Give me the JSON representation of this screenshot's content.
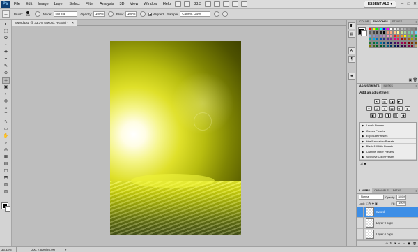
{
  "menubar": {
    "logo": "Ps",
    "items": [
      "File",
      "Edit",
      "Image",
      "Layer",
      "Select",
      "Filter",
      "Analysis",
      "3D",
      "View",
      "Window",
      "Help"
    ],
    "zoom": "33.3",
    "workspace": "ESSENTIALS ▾",
    "win_min": "–",
    "win_max": "□",
    "win_close": "✕"
  },
  "options": {
    "brush_label": "Brush:",
    "brush_size": "336",
    "mode_label": "Mode:",
    "mode_value": "Normal",
    "opacity_label": "Opacity:",
    "opacity_value": "100%",
    "flow_label": "Flow:",
    "flow_value": "100%",
    "aligned_label": "Aligned",
    "sample_label": "Sample:",
    "sample_value": "Current Layer"
  },
  "document": {
    "tab_title": "Sword.psd @ 33.3% (Sword, RGB/8) *",
    "tab_close": "×"
  },
  "tools": [
    "▸",
    "⬚",
    "ʘ",
    "⌁",
    "✥",
    "⌖",
    "✎",
    "⊕",
    "✚",
    "▣",
    "◐",
    "◍",
    "⌂",
    "T",
    "↖",
    "▭",
    "✋",
    "⌕",
    "◎",
    "▦",
    "▤",
    "◫",
    "⬒",
    "⊞",
    "⊟",
    "◴",
    "◷",
    "⧉",
    "⚲"
  ],
  "statusbar": {
    "zoom": "33.33%",
    "doc": "Doc: 7.60M/26.9M",
    "arrow": "▸"
  },
  "panels": {
    "swatches": {
      "tabs": [
        "COLOR",
        "SWATCHES",
        "STYLES"
      ],
      "active": 1,
      "menu": "≡",
      "colors": [
        "#ff0000",
        "#ffff00",
        "#00ff00",
        "#00ffff",
        "#0000ff",
        "#ff00ff",
        "#ffffff",
        "#ebebeb",
        "#d6d6d6",
        "#c2c2c2",
        "#adadad",
        "#999999",
        "#858585",
        "#707070",
        "#5c5c5c",
        "#474747",
        "#333333",
        "#1f1f1f",
        "#000000",
        "#f7977a",
        "#f9ad81",
        "#fdc68a",
        "#fff79a",
        "#c4df9b",
        "#a3d39c",
        "#82ca9d",
        "#7bcdc8",
        "#6ecff6",
        "#7ea7d8",
        "#8493ca",
        "#8882be",
        "#a187be",
        "#bc8dbf",
        "#f49ac2",
        "#f6989d",
        "#ed1c24",
        "#f26522",
        "#f7941d",
        "#fff200",
        "#8dc63f",
        "#39b54a",
        "#00a651",
        "#00a99d",
        "#00aeef",
        "#0072bc",
        "#0054a6",
        "#2e3192",
        "#662d91",
        "#92278f",
        "#ec008c",
        "#ed145b",
        "#9e0b0f",
        "#a0410d",
        "#a36209",
        "#aba000",
        "#598527",
        "#197b30",
        "#007236",
        "#00746b",
        "#0076a3",
        "#004b80",
        "#003471",
        "#1b1464",
        "#440e62",
        "#630460",
        "#9e005d",
        "#9e0039",
        "#790000",
        "#7b2e00",
        "#7d4900",
        "#827b00",
        "#406618",
        "#005e20",
        "#005826",
        "#005952",
        "#005b7f",
        "#003663",
        "#002157",
        "#0d004c",
        "#32004b",
        "#4b0049",
        "#7b0046",
        "#7a0026",
        "#c69c6e"
      ],
      "footer": "▣ 🗑"
    },
    "adjustments": {
      "tabs": [
        "ADJUSTMENTS",
        "MASKS"
      ],
      "active": 0,
      "menu": "≡",
      "title": "Add an adjustment",
      "row1": [
        "☀",
        "▥",
        "◪",
        "◩",
        "▽"
      ],
      "row2": [
        "▼",
        "⚖",
        "◑",
        "▦",
        "◐",
        "◕"
      ],
      "row3": [
        "▣",
        "◧",
        "◨",
        "▨",
        "◆"
      ],
      "presets": [
        "Levels Presets",
        "Curves Presets",
        "Exposure Presets",
        "Hue/Saturation Presets",
        "Black & White Presets",
        "Channel Mixer Presets",
        "Selective Color Presets"
      ],
      "tri": "▶",
      "footer": "⇲ ◉"
    },
    "layers": {
      "tabs": [
        "LAYERS",
        "CHANNELS",
        "PATHS"
      ],
      "active": 0,
      "menu": "≡",
      "blend": "Normal",
      "opacity_label": "Opacity:",
      "opacity_value": "100%",
      "lock_label": "Lock:",
      "fill_label": "Fill:",
      "fill_value": "100%",
      "items": [
        {
          "name": "Sword",
          "eye": "",
          "selected": true
        },
        {
          "name": "Layer 9 copy",
          "eye": "",
          "selected": false
        },
        {
          "name": "Layer 6 copy",
          "eye": "",
          "selected": false
        }
      ],
      "footer": [
        "∞",
        "fx",
        "◙",
        "◐",
        "▭",
        "▣",
        "🗑"
      ]
    }
  },
  "strip_icons": [
    "◧",
    "▤",
    "A|",
    "¶",
    "◈"
  ]
}
